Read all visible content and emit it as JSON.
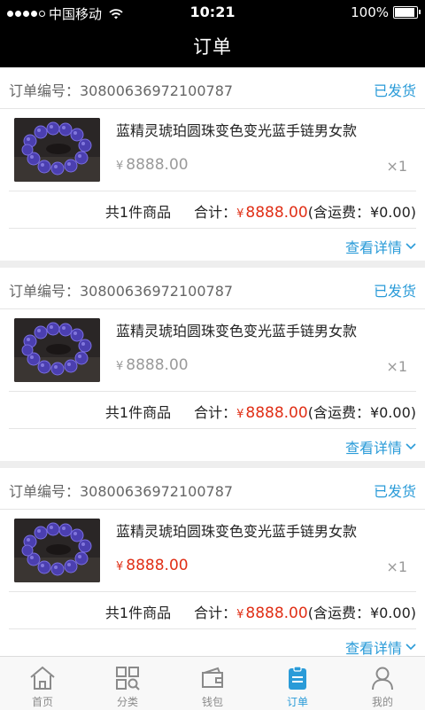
{
  "status_bar": {
    "carrier": "中国移动",
    "time": "10:21",
    "battery": "100%",
    "battery_level": 1.0,
    "signal_bars": 4,
    "signal_max": 5
  },
  "nav": {
    "title": "订单"
  },
  "orders": [
    {
      "order_no_label": "订单编号：30800636972100787",
      "status": "已发货",
      "item_name": "蓝精灵琥珀圆珠变色变光蓝手链男女款",
      "currency": "¥",
      "price": "8888.00",
      "qty": "×1",
      "count_text": "共1件商品",
      "total_label": "合计：",
      "total_amount": "8888.00",
      "shipping_text": "(含运费：¥0.00)",
      "detail_link": "查看详情"
    },
    {
      "order_no_label": "订单编号：30800636972100787",
      "status": "已发货",
      "item_name": "蓝精灵琥珀圆珠变色变光蓝手链男女款",
      "currency": "¥",
      "price": "8888.00",
      "qty": "×1",
      "count_text": "共1件商品",
      "total_label": "合计：",
      "total_amount": "8888.00",
      "shipping_text": "(含运费：¥0.00)",
      "detail_link": "查看详情"
    },
    {
      "order_no_label": "订单编号：30800636972100787",
      "status": "已发货",
      "item_name": "蓝精灵琥珀圆珠变色变光蓝手链男女款",
      "currency": "¥",
      "price": "8888.00",
      "qty": "×1",
      "count_text": "共1件商品",
      "total_label": "合计：",
      "total_amount": "8888.00",
      "shipping_text": "(含运费：¥0.00)",
      "detail_link": "查看详情"
    }
  ],
  "tabbar": {
    "items": [
      {
        "label": "首页",
        "icon": "home-icon"
      },
      {
        "label": "分类",
        "icon": "category-icon"
      },
      {
        "label": "钱包",
        "icon": "wallet-icon"
      },
      {
        "label": "订单",
        "icon": "order-icon",
        "active": true
      },
      {
        "label": "我的",
        "icon": "user-icon"
      }
    ]
  },
  "colors": {
    "accent": "#2a9bd8",
    "price_red": "#e02f16",
    "header_bg": "#000000",
    "page_bg": "#eeeeee"
  }
}
